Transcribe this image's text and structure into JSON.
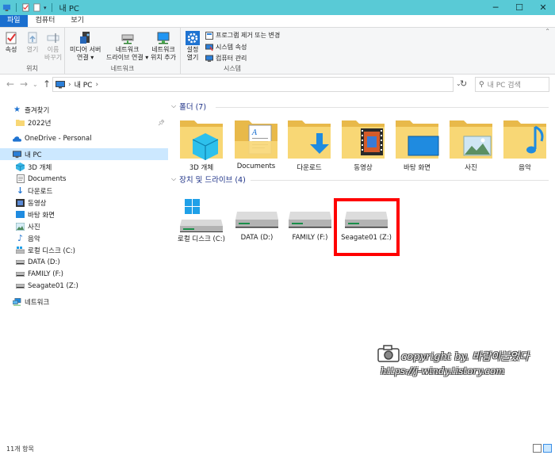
{
  "window": {
    "title": "내 PC"
  },
  "window_buttons": {
    "minimize": "─",
    "maximize": "☐",
    "close": "✕"
  },
  "ribbon_tabs": [
    "파일",
    "컴퓨터",
    "보기"
  ],
  "ribbon": {
    "groups": {
      "location": "위치",
      "network": "네트워크",
      "system": "시스템"
    },
    "location_buttons": [
      {
        "label": "속성",
        "enabled": true
      },
      {
        "label": "열기",
        "enabled": false
      },
      {
        "label": "이름\n바꾸기",
        "enabled": false
      }
    ],
    "network_buttons": [
      {
        "label": "미디어 서버\n연결 ▾"
      },
      {
        "label": "네트워크\n드라이브 연결 ▾"
      },
      {
        "label": "네트워크\n위치 추가"
      }
    ],
    "settings_button": "설정\n열기",
    "system_items": [
      "프로그램 제거 또는 변경",
      "시스템 속성",
      "컴퓨터 관리"
    ]
  },
  "addressbar": {
    "path_label": "내 PC",
    "search_placeholder": "내 PC 검색"
  },
  "nav": {
    "quick_access": "즐겨찾기",
    "quick_items": [
      "2022년"
    ],
    "onedrive": "OneDrive - Personal",
    "this_pc": "내 PC",
    "pc_items": [
      "3D 개체",
      "Documents",
      "다운로드",
      "동영상",
      "바탕 화면",
      "사진",
      "음악",
      "로컬 디스크 (C:)",
      "DATA (D:)",
      "FAMILY (F:)",
      "Seagate01 (Z:)"
    ],
    "network": "네트워크"
  },
  "content": {
    "folders_header": "폴더 (7)",
    "folders": [
      "3D 개체",
      "Documents",
      "다운로드",
      "동영상",
      "바탕 화면",
      "사진",
      "음악"
    ],
    "drives_header": "장치 및 드라이브 (4)",
    "drives": [
      "로컬 디스크 (C:)",
      "DATA (D:)",
      "FAMILY (F:)",
      "Seagate01 (Z:)"
    ]
  },
  "watermark": {
    "line1": "copyright by. 바람이불었다",
    "line2": "https://j-windy.tistory.com"
  },
  "status": {
    "count": "11개 항목"
  },
  "colors": {
    "titlebar": "#59cad6",
    "file_tab": "#1a6fcf",
    "selection": "#cce8ff",
    "highlight": "#ff0000",
    "folder": "#f8d775"
  }
}
